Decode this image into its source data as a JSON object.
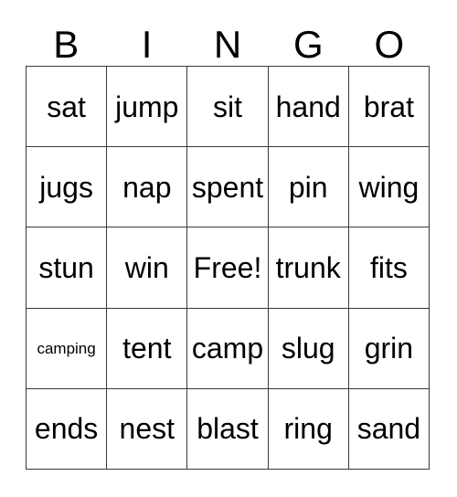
{
  "header": {
    "letters": [
      "B",
      "I",
      "N",
      "G",
      "O"
    ]
  },
  "grid": {
    "rows": [
      [
        "sat",
        "jump",
        "sit",
        "hand",
        "brat"
      ],
      [
        "jugs",
        "nap",
        "spent",
        "pin",
        "wing"
      ],
      [
        "stun",
        "win",
        "Free!",
        "trunk",
        "fits"
      ],
      [
        "camping",
        "tent",
        "camp",
        "slug",
        "grin"
      ],
      [
        "ends",
        "nest",
        "blast",
        "ring",
        "sand"
      ]
    ],
    "free_space": "Free!",
    "columns": 5,
    "row_count": 5
  },
  "colors": {
    "background": "#ffffff",
    "text": "#000000",
    "grid_line": "#3a3a3a"
  }
}
